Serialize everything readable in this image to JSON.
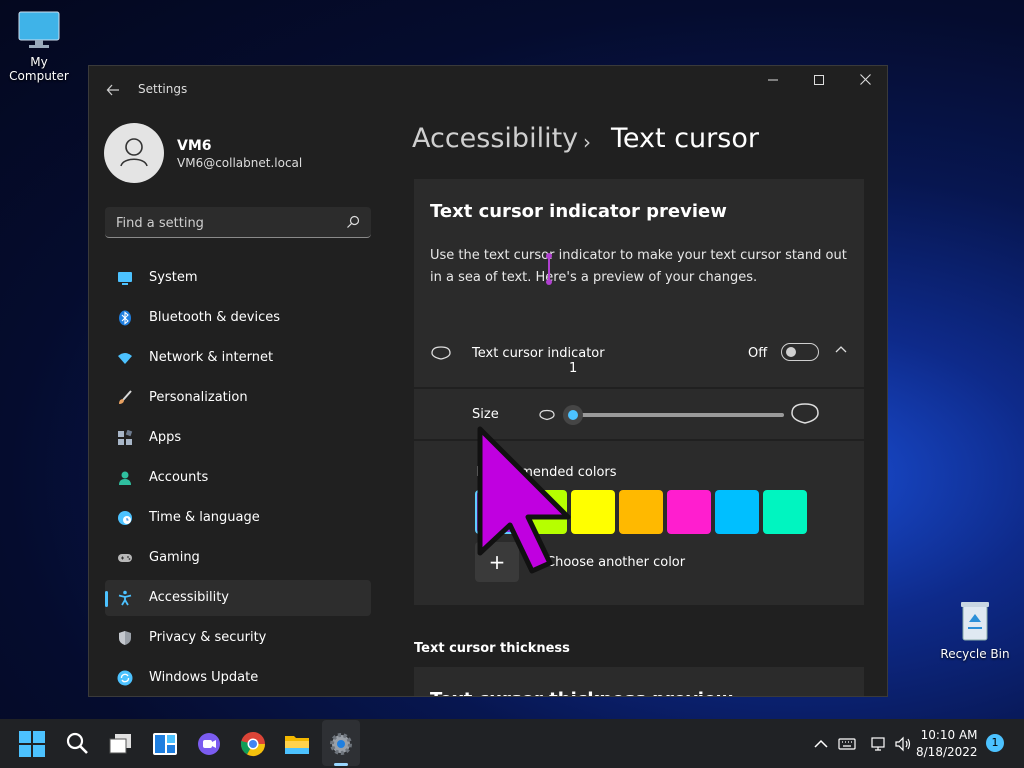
{
  "desktop": {
    "icons": [
      {
        "label": "My Computer",
        "icon": "monitor-icon"
      },
      {
        "label": "Recycle Bin",
        "icon": "recycle-bin-icon"
      }
    ]
  },
  "window": {
    "app_title": "Settings",
    "user": {
      "name": "VM6",
      "email": "VM6@collabnet.local"
    },
    "search": {
      "placeholder": "Find a setting"
    },
    "nav": [
      {
        "label": "System",
        "icon": "system-icon",
        "color": "#4cc2ff"
      },
      {
        "label": "Bluetooth & devices",
        "icon": "bluetooth-icon",
        "color": "#1f7fe0"
      },
      {
        "label": "Network & internet",
        "icon": "wifi-icon",
        "color": "#4cc2ff"
      },
      {
        "label": "Personalization",
        "icon": "brush-icon",
        "color": "#e8a060"
      },
      {
        "label": "Apps",
        "icon": "apps-icon",
        "color": "#a8b6c8"
      },
      {
        "label": "Accounts",
        "icon": "accounts-icon",
        "color": "#2fc0a0"
      },
      {
        "label": "Time & language",
        "icon": "clock-globe-icon",
        "color": "#4cc2ff"
      },
      {
        "label": "Gaming",
        "icon": "gamepad-icon",
        "color": "#b8b8b8"
      },
      {
        "label": "Accessibility",
        "icon": "accessibility-icon",
        "color": "#4cc2ff",
        "selected": true
      },
      {
        "label": "Privacy & security",
        "icon": "shield-icon",
        "color": "#9aa0a8"
      },
      {
        "label": "Windows Update",
        "icon": "update-icon",
        "color": "#4cc2ff"
      }
    ],
    "breadcrumb": {
      "parent": "Accessibility",
      "separator": "›",
      "current": "Text cursor"
    },
    "preview": {
      "title": "Text cursor indicator preview",
      "description": "Use the text cursor indicator to make your text cursor stand out in a sea of text. Here's a preview of your changes."
    },
    "indicator": {
      "label": "Text cursor indicator",
      "state": "Off",
      "enabled": false
    },
    "size": {
      "label": "Size",
      "value": "1"
    },
    "colors": {
      "label": "Recommended colors",
      "swatches": [
        "#8a2be2",
        "#b6ff00",
        "#ffff00",
        "#ffb900",
        "#ff1ecf",
        "#00bfff",
        "#00f5c0"
      ],
      "selected_index": 0,
      "choose_label": "Choose another color",
      "choose_symbol": "+"
    },
    "thickness": {
      "section_label": "Text cursor thickness",
      "card_title": "Text cursor thickness preview"
    }
  },
  "taskbar": {
    "time": "10:10 AM",
    "date": "8/18/2022",
    "notification_count": "1",
    "accent": "#4cc2ff"
  }
}
